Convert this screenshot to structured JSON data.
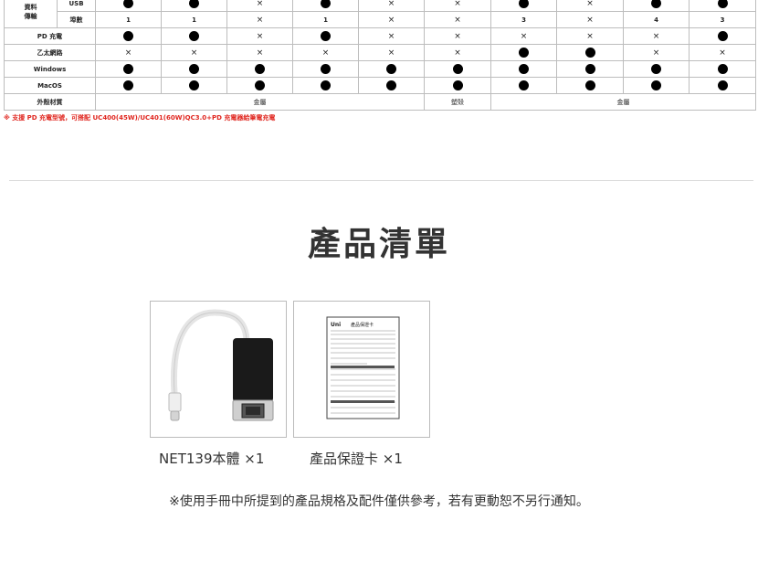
{
  "spec_table": {
    "group_label": "資料\n傳輸",
    "rows": [
      {
        "label": "USB",
        "cells": [
          "dot",
          "dot",
          "x",
          "dot",
          "x",
          "x",
          "dot",
          "x",
          "dot",
          "dot"
        ]
      },
      {
        "label": "埠數",
        "cells": [
          "1",
          "1",
          "x",
          "1",
          "x",
          "x",
          "3",
          "x",
          "4",
          "3"
        ]
      },
      {
        "label": "PD 充電",
        "cells": [
          "dot",
          "dot",
          "x",
          "dot",
          "x",
          "x",
          "x",
          "x",
          "x",
          "dot"
        ]
      },
      {
        "label": "乙太網路",
        "cells": [
          "x",
          "x",
          "x",
          "x",
          "x",
          "x",
          "dot",
          "dot",
          "x",
          "x"
        ]
      },
      {
        "label": "Windows",
        "cells": [
          "dot",
          "dot",
          "dot",
          "dot",
          "dot",
          "dot",
          "dot",
          "dot",
          "dot",
          "dot"
        ]
      },
      {
        "label": "MacOS",
        "cells": [
          "dot",
          "dot",
          "dot",
          "dot",
          "dot",
          "dot",
          "dot",
          "dot",
          "dot",
          "dot"
        ]
      }
    ],
    "material": {
      "label": "外殼材質",
      "metal1": "金屬",
      "plastic": "塑殼",
      "metal2": "金屬"
    },
    "x_symbol": "×"
  },
  "note": "※ 支援 PD 充電型號，可搭配 UC400(45W)/UC401(60W)QC3.0+PD 充電器給筆電充電",
  "section_title": "產品清單",
  "items": [
    {
      "caption": "NET139本體 ×1"
    },
    {
      "caption": "產品保證卡 ×1"
    }
  ],
  "warranty_card": {
    "brand": "Uni",
    "title": "產品保證卡"
  },
  "disclaimer": "※使用手冊中所提到的產品規格及配件僅供參考，若有更動恕不另行通知。"
}
